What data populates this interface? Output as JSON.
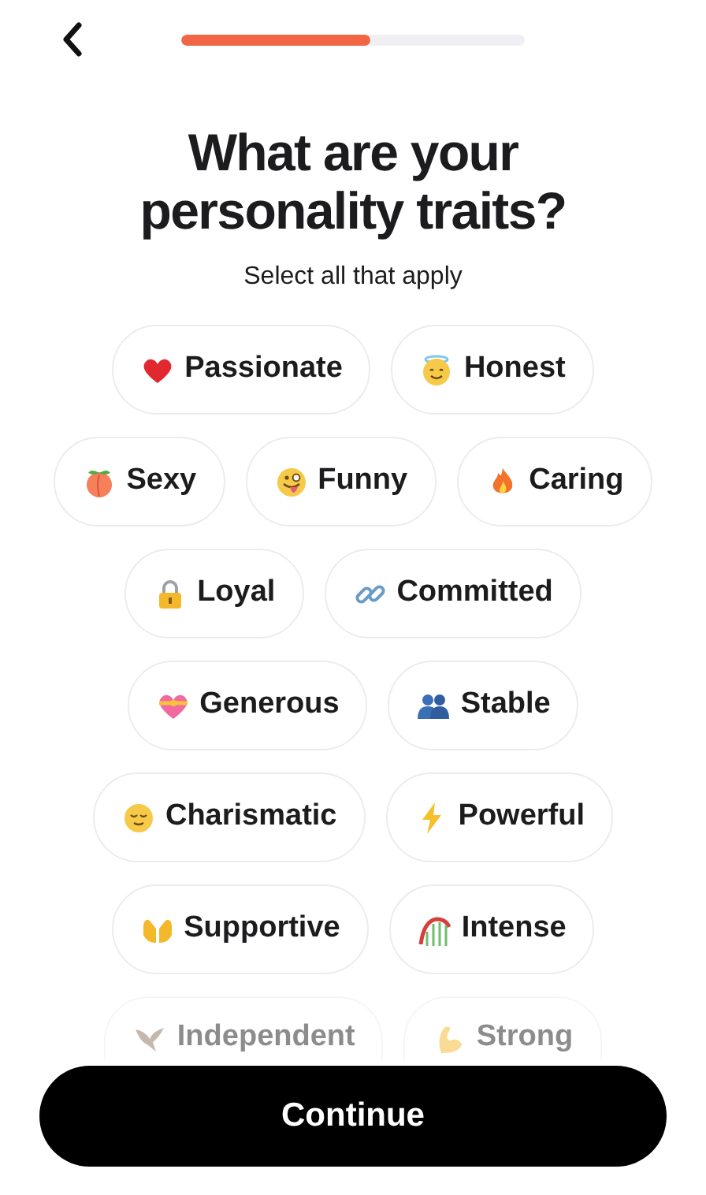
{
  "progress": {
    "level": 0.55
  },
  "title": "What are your personality traits?",
  "subtitle": "Select all that apply",
  "trait_rows": [
    [
      {
        "label": "Passionate",
        "selected": false
      },
      {
        "label": "Honest",
        "selected": false
      }
    ],
    [
      {
        "label": "Sexy",
        "selected": false
      },
      {
        "label": "Funny",
        "selected": false
      },
      {
        "label": "Caring",
        "selected": false
      }
    ],
    [
      {
        "label": "Loyal",
        "selected": false
      },
      {
        "label": "Committed",
        "selected": false
      }
    ],
    [
      {
        "label": "Generous",
        "selected": false
      },
      {
        "label": "Stable",
        "selected": false
      }
    ],
    [
      {
        "label": "Charismatic",
        "selected": false
      },
      {
        "label": "Powerful",
        "selected": false
      }
    ],
    [
      {
        "label": "Supportive",
        "selected": false
      },
      {
        "label": "Intense",
        "selected": false
      }
    ],
    [
      {
        "label": "Independent",
        "selected": false
      },
      {
        "label": "Strong",
        "selected": false
      }
    ]
  ],
  "continue_button": "Continue"
}
